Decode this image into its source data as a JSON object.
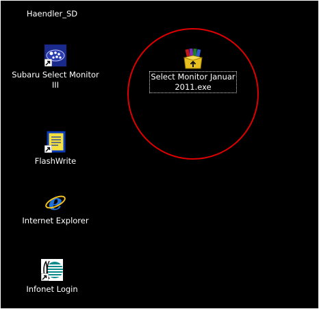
{
  "desktop": {
    "icons": [
      {
        "name": "Haendler_SD",
        "icon": "folder-icon-offscreen"
      },
      {
        "name": "Subaru Select Monitor\nIII",
        "icon": "subaru-logo-icon",
        "shortcut": true
      },
      {
        "name": "Select Monitor Januar\n2011.exe",
        "icon": "winrar-archive-icon",
        "selected": true
      },
      {
        "name": "FlashWrite",
        "icon": "document-icon",
        "shortcut": true
      },
      {
        "name": "Internet Explorer",
        "icon": "internet-explorer-icon"
      },
      {
        "name": "Infonet Login",
        "icon": "infonet-globe-icon",
        "shortcut": true
      }
    ],
    "highlight_color": "#e00000",
    "background_color": "#000000"
  }
}
